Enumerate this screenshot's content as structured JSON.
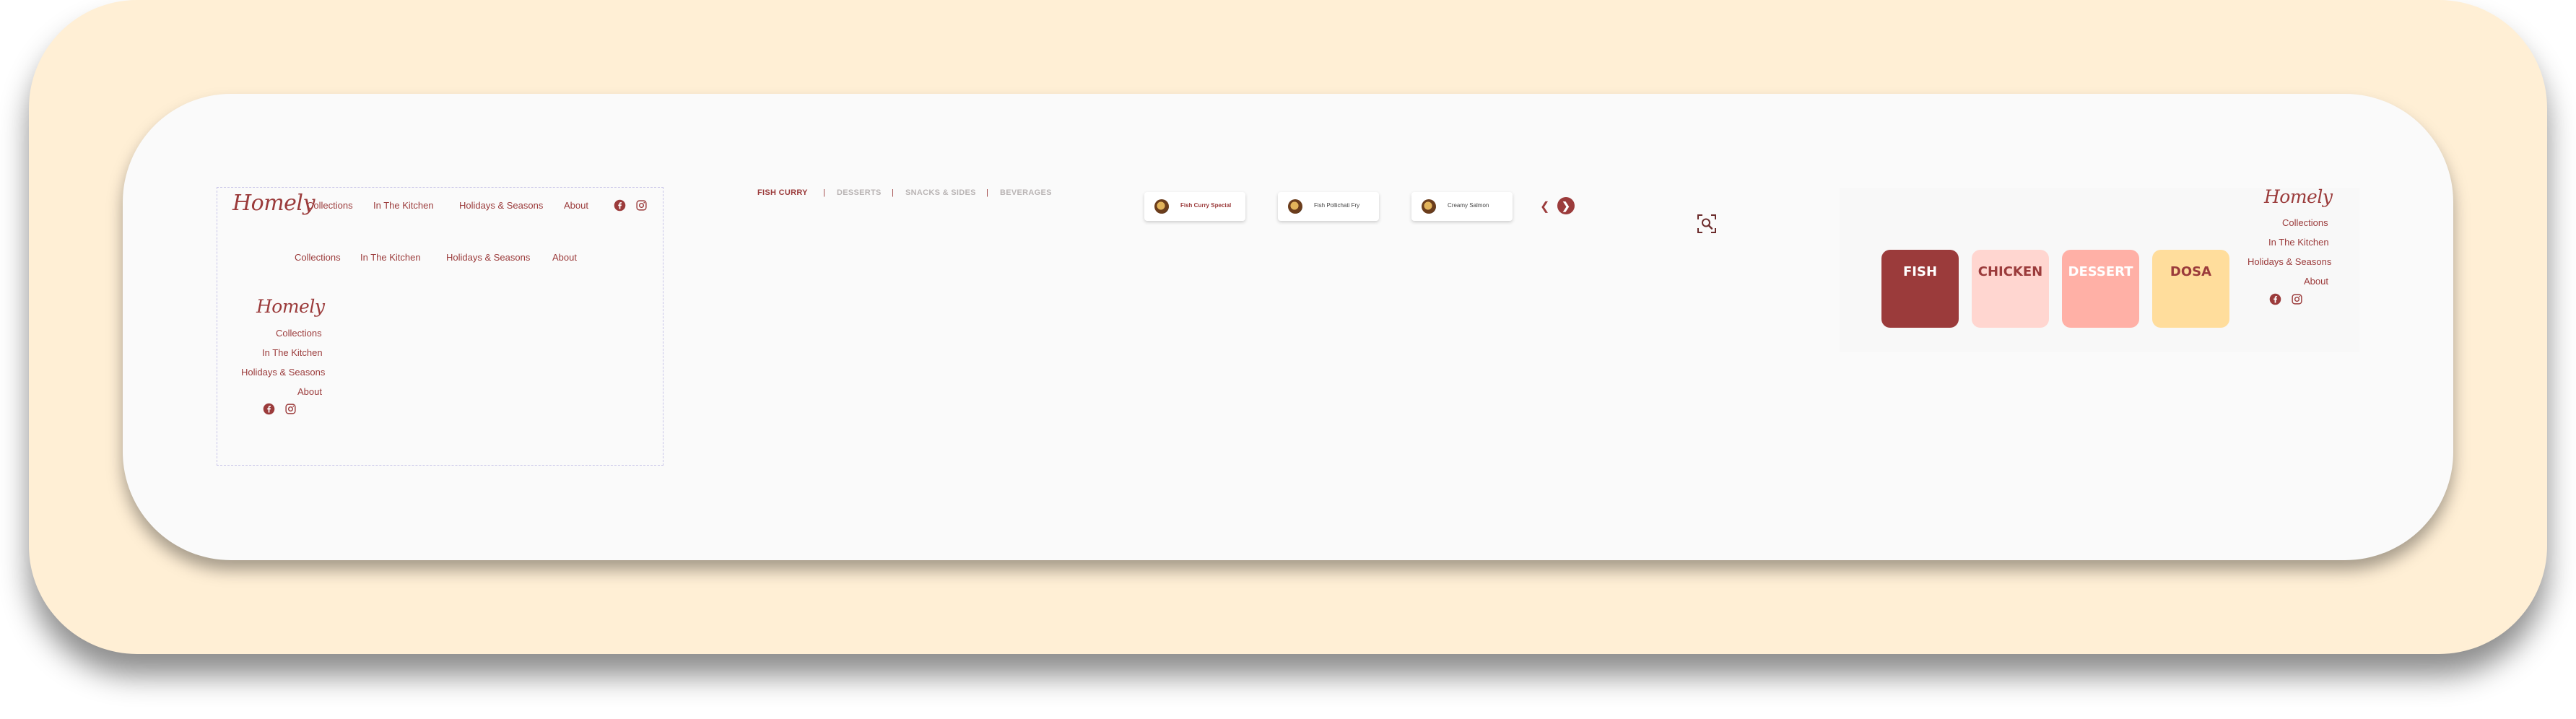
{
  "brand": {
    "logo_text": "Homely"
  },
  "nav": {
    "items": [
      {
        "label": "Collections"
      },
      {
        "label": "In The Kitchen"
      },
      {
        "label": "Holidays & Seasons"
      },
      {
        "label": "About"
      }
    ],
    "social": [
      {
        "icon": "facebook-icon"
      },
      {
        "icon": "instagram-icon"
      }
    ]
  },
  "tabs": {
    "items": [
      {
        "label": "FISH CURRY",
        "active": true
      },
      {
        "label": "DESSERTS",
        "active": false
      },
      {
        "label": "SNACKS & SIDES",
        "active": false
      },
      {
        "label": "BEVERAGES",
        "active": false
      }
    ],
    "separator": "|"
  },
  "carousel": {
    "cards": [
      {
        "label": "Fish Curry Special",
        "active": true
      },
      {
        "label": "Fish Pollichati Fry",
        "active": false
      },
      {
        "label": "Creamy Salmon",
        "active": false
      }
    ],
    "prev_icon": "chevron-left-icon",
    "next_icon": "chevron-right-icon"
  },
  "tools": {
    "zoom_icon": "zoom-select-icon"
  },
  "categories": [
    {
      "label": "FISH",
      "bg": "#9b3b3b",
      "fg": "#ffffff"
    },
    {
      "label": "CHICKEN",
      "bg": "#ffd6d0",
      "fg": "#9b3b3b"
    },
    {
      "label": "DESSERT",
      "bg": "#ffb0a6",
      "fg": "#ffffff"
    },
    {
      "label": "DOSA",
      "bg": "#ffdd9c",
      "fg": "#9b3b3b"
    }
  ],
  "colors": {
    "accent": "#9b3b3b",
    "outer_bg": "#ffefd5",
    "inner_bg": "#fafafa"
  }
}
